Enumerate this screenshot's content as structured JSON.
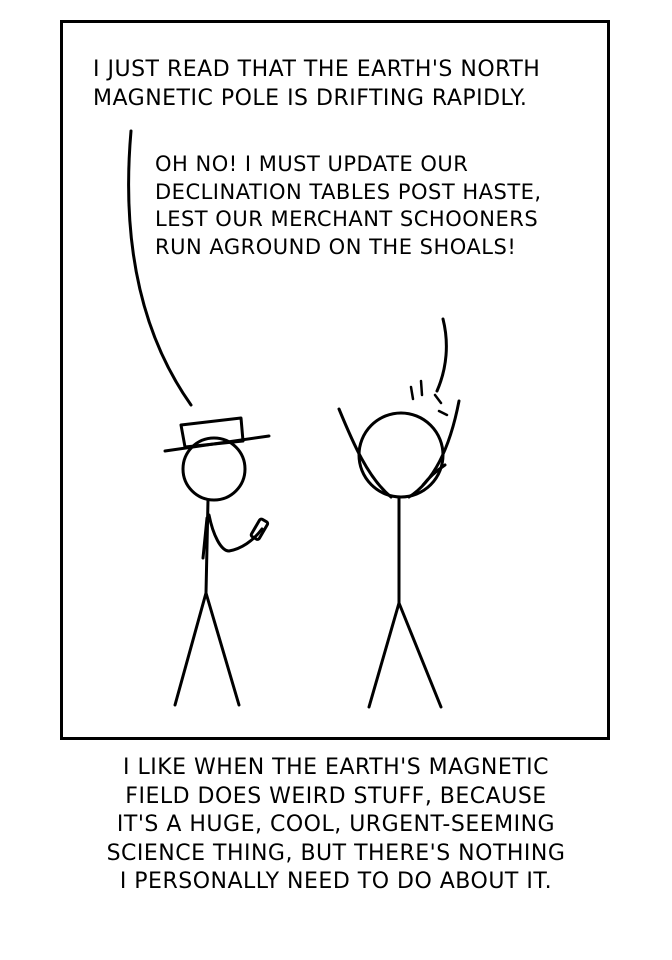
{
  "panel": {
    "speech_1": "I just read that the Earth's north\nmagnetic pole is drifting rapidly.",
    "speech_2": "Oh no! I must update our\ndeclination tables post haste,\nlest our merchant schooners\nrun aground on the shoals!"
  },
  "caption": "I like when the Earth's magnetic\nfield does weird stuff, because\nit's a huge, cool, urgent-seeming\nscience thing, but there's nothing\nI personally need to do about it.",
  "icons": {
    "character_left": "stick-figure-with-hat-holding-phone",
    "character_right": "stick-figure-arms-raised-alarmed"
  },
  "colors": {
    "ink": "#000000",
    "background": "#ffffff"
  }
}
